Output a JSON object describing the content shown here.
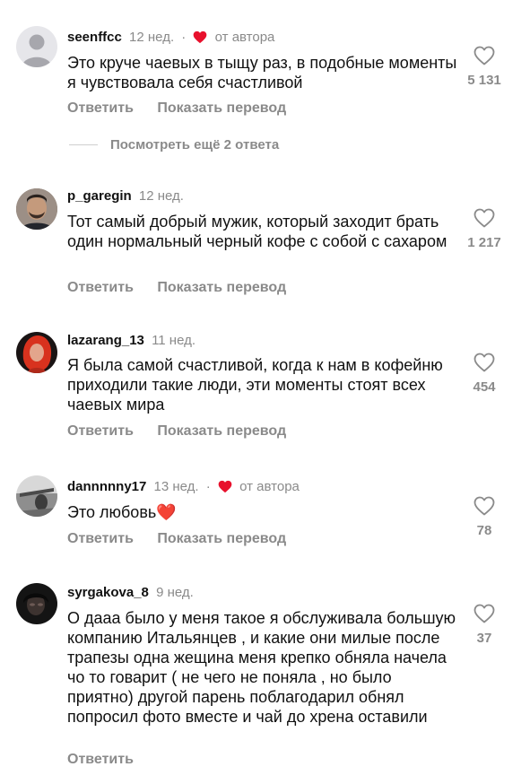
{
  "colors": {
    "heart": "#e8112d",
    "muted": "#8a8a8a"
  },
  "comments": [
    {
      "username": "seenffcc",
      "time": "12 нед.",
      "author_liked": true,
      "author_label": "от автора",
      "text": "Это круче чаевых в тыщу раз, в подобные моменты я чувствовала себя счастливой",
      "reply": "Ответить",
      "translate": "Показать перевод",
      "likes": "5 131"
    },
    {
      "username": "p_garegin",
      "time": "12 нед.",
      "author_liked": false,
      "text": "Тот самый добрый мужик, который заходит брать один нормальный черный кофе с собой с сахаром",
      "reply": "Ответить",
      "translate": "Показать перевод",
      "likes": "1 217"
    },
    {
      "username": "lazarang_13",
      "time": "11 нед.",
      "author_liked": false,
      "text": "Я была самой счастливой, когда к нам в кофейню приходили такие люди, эти моменты стоят всех чаевых мира",
      "reply": "Ответить",
      "translate": "Показать перевод",
      "likes": "454"
    },
    {
      "username": "dannnnny17",
      "time": "13 нед.",
      "author_liked": true,
      "author_label": "от автора",
      "text": "Это любовь❤️",
      "reply": "Ответить",
      "translate": "Показать перевод",
      "likes": "78"
    },
    {
      "username": "syrgakova_8",
      "time": "9 нед.",
      "author_liked": false,
      "text": "О дааа было у меня такое я обслуживала большую компанию Итальянцев , и какие они милые после  трапезы одна жещина меня крепко обняла начела чо то говарит ( не чего не поняла , но было приятно)  другой парень поблагодарил обнял попросил фото вместе  и чай до хрена оставили",
      "reply": "Ответить",
      "likes": "37"
    }
  ],
  "view_more_replies": "Посмотреть ещё 2 ответа"
}
